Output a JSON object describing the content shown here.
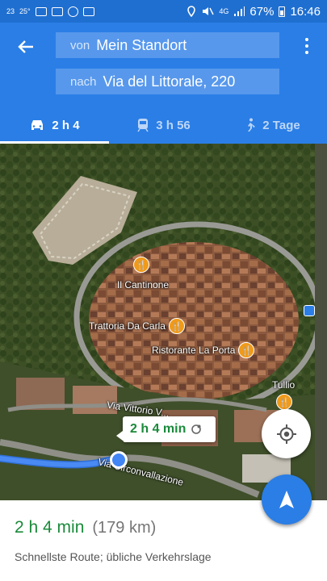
{
  "status_bar": {
    "left_items": [
      "23",
      "25°"
    ],
    "icons_left": [
      "gmail-icon",
      "gmail-icon",
      "refresh-icon",
      "app-icon"
    ],
    "network": "4G",
    "battery": "67%",
    "time": "16:46"
  },
  "header": {
    "from_prefix": "von",
    "from_value": "Mein Standort",
    "to_prefix": "nach",
    "to_value": "Via del Littorale, 220",
    "tabs": [
      {
        "icon": "car-icon",
        "label": "2 h 4"
      },
      {
        "icon": "train-icon",
        "label": "3 h 56"
      },
      {
        "icon": "walk-icon",
        "label": "2 Tage"
      }
    ],
    "active_tab": 0
  },
  "map": {
    "pois": [
      {
        "name": "Il Cantinone"
      },
      {
        "name": "Trattoria Da Carla"
      },
      {
        "name": "Ristorante La Porta"
      },
      {
        "name": "Tullio"
      }
    ],
    "streets": [
      "Via Vittorio V...",
      "Via Circonvallazione"
    ],
    "route_bubble": "2 h 4 min",
    "route_color": "#4a8af4"
  },
  "bottom": {
    "duration": "2 h 4 min",
    "distance": "(179 km)",
    "description": "Schnellste Route; übliche Verkehrslage"
  },
  "colors": {
    "header_bg": "#2a7ee6",
    "status_bg": "#1f6fd0",
    "duration_green": "#1a8a3a"
  }
}
